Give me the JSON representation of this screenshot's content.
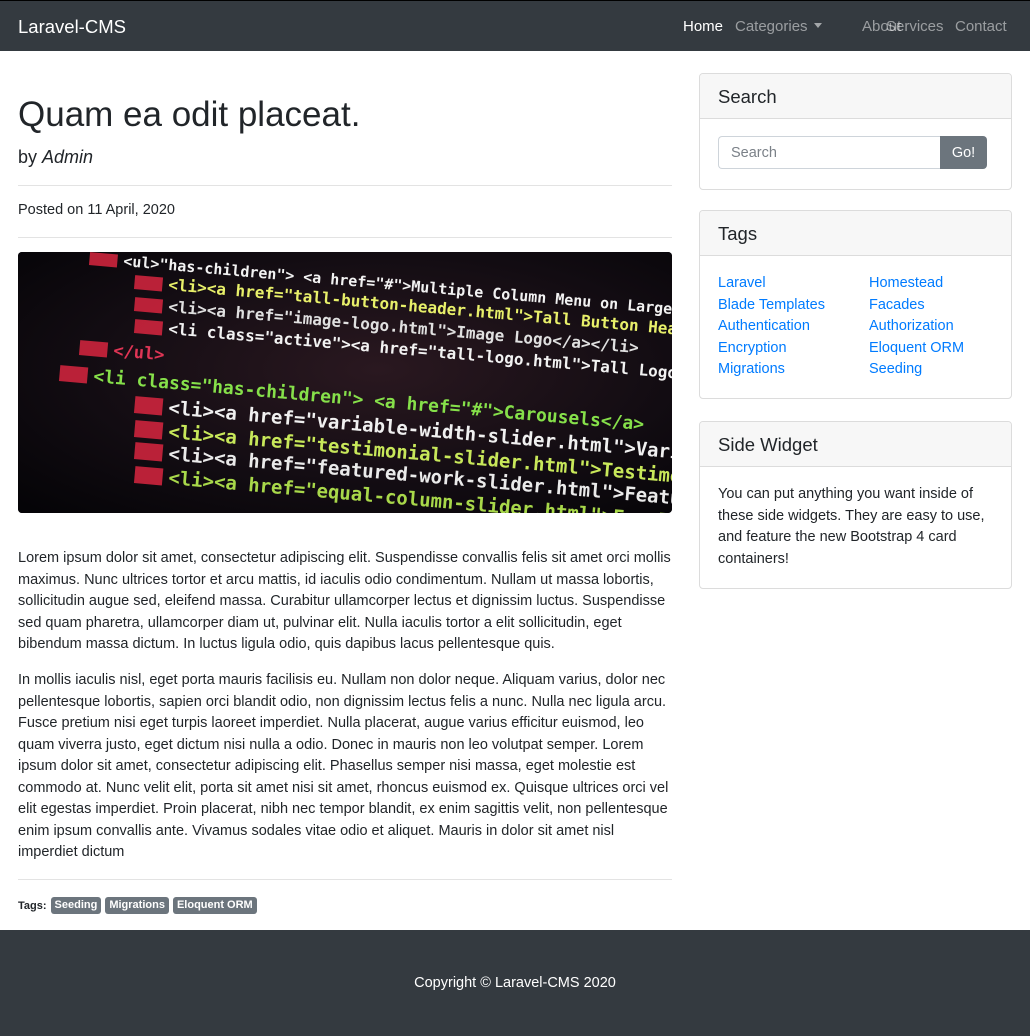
{
  "navbar": {
    "brand": "Laravel-CMS",
    "links": {
      "home": "Home",
      "categories": "Categories",
      "about": "About",
      "services": "Services",
      "contact": "Contact"
    },
    "background_color": "#343a40"
  },
  "post": {
    "title": "Quam ea odit placeat.",
    "by_prefix": "by",
    "author": "Admin",
    "posted_on_prefix": "Posted on",
    "posted_date": "11 April, 2020",
    "hero_image": {
      "icon": "code-screenshot-image",
      "code_lines": [
        "<ul>\"has-children\"> <a href=\"#\">Multiple Column Menu on Larger Viewports",
        "<li><a href=\"tall-button-header.html\">Tall Button Header</a></li>",
        "<li><a href=\"image-logo.html\">Image Logo</a></li>",
        "<li class=\"active\"><a href=\"tall-logo.html\">Tall Logo Image</a></li>",
        "</ul>",
        "<li class=\"has-children\"> <a href=\"#\">Carousels</a>",
        "<li><a href=\"variable-width-slider.html\">Variable Image Width</a>",
        "<li><a href=\"testimonial-slider.html\">Testimonial Slider</a>",
        "<li><a href=\"featured-work-slider.html\">Featured Work Slider</a>",
        "<li><a href=\"equal-column-slider.html\">Equal Column Slider</a>"
      ]
    },
    "paragraphs": [
      "Lorem ipsum dolor sit amet, consectetur adipiscing elit. Suspendisse convallis felis sit amet orci mollis maximus. Nunc ultrices tortor et arcu mattis, id iaculis odio condimentum. Nullam ut massa lobortis, sollicitudin augue sed, eleifend massa. Curabitur ullamcorper lectus et dignissim luctus. Suspendisse sed quam pharetra, ullamcorper diam ut, pulvinar elit. Nulla iaculis tortor a elit sollicitudin, eget bibendum massa dictum. In luctus ligula odio, quis dapibus lacus pellentesque quis.",
      "In mollis iaculis nisl, eget porta mauris facilisis eu. Nullam non dolor neque. Aliquam varius, dolor nec pellentesque lobortis, sapien orci blandit odio, non dignissim lectus felis a nunc. Nulla nec ligula arcu. Fusce pretium nisi eget turpis laoreet imperdiet. Nulla placerat, augue varius efficitur euismod, leo quam viverra justo, eget dictum nisi nulla a odio. Donec in mauris non leo volutpat semper. Lorem ipsum dolor sit amet, consectetur adipiscing elit. Phasellus semper nisi massa, eget molestie est commodo at. Nunc velit elit, porta sit amet nisi sit amet, rhoncus euismod ex. Quisque ultrices orci vel elit egestas imperdiet. Proin placerat, nibh nec tempor blandit, ex enim sagittis velit, non pellentesque enim ipsum convallis ante. Vivamus sodales vitae odio et aliquet. Mauris in dolor sit amet nisl imperdiet dictum"
    ],
    "tags_label": "Tags:",
    "tags": [
      "Seeding",
      "Migrations",
      "Eloquent ORM"
    ]
  },
  "sidebar": {
    "search": {
      "title": "Search",
      "placeholder": "Search",
      "value": "",
      "button_label": "Go!"
    },
    "tags": {
      "title": "Tags",
      "left": [
        "Laravel",
        "Blade Templates",
        "Authentication",
        "Encryption",
        "Migrations"
      ],
      "right": [
        "Homestead",
        "Facades",
        "Authorization",
        "Eloquent ORM",
        "Seeding"
      ]
    },
    "side_widget": {
      "title": "Side Widget",
      "text": "You can put anything you want inside of these side widgets. They are easy to use, and feature the new Bootstrap 4 card containers!"
    }
  },
  "footer": {
    "copyright": "Copyright © Laravel-CMS 2020"
  },
  "colors": {
    "link": "#007bff",
    "badge": "#6c757d",
    "button": "#6c757d",
    "footer": "#343a40"
  }
}
